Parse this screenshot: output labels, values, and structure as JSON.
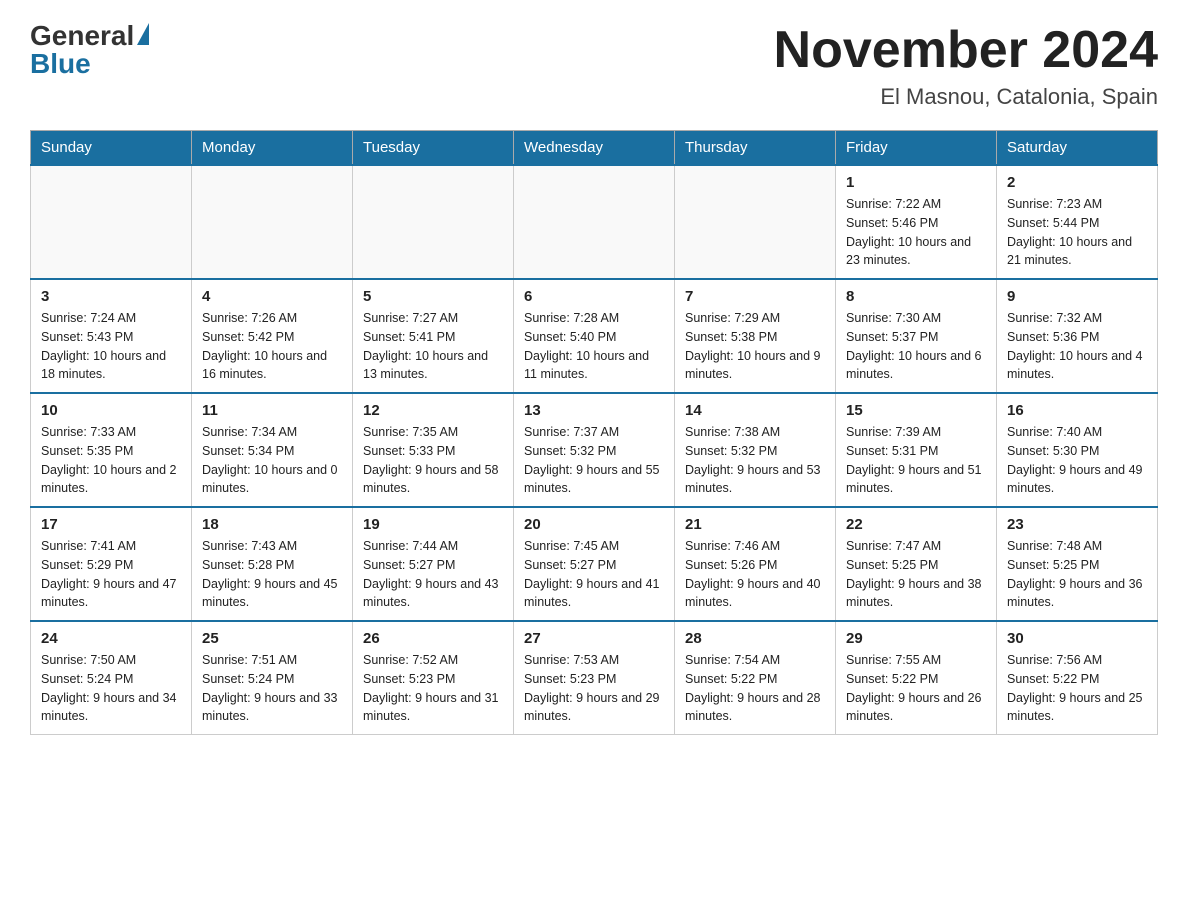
{
  "header": {
    "logo_general": "General",
    "logo_blue": "Blue",
    "month_year": "November 2024",
    "location": "El Masnou, Catalonia, Spain"
  },
  "days_of_week": [
    "Sunday",
    "Monday",
    "Tuesday",
    "Wednesday",
    "Thursday",
    "Friday",
    "Saturday"
  ],
  "weeks": [
    [
      {
        "day": "",
        "info": ""
      },
      {
        "day": "",
        "info": ""
      },
      {
        "day": "",
        "info": ""
      },
      {
        "day": "",
        "info": ""
      },
      {
        "day": "",
        "info": ""
      },
      {
        "day": "1",
        "info": "Sunrise: 7:22 AM\nSunset: 5:46 PM\nDaylight: 10 hours and 23 minutes."
      },
      {
        "day": "2",
        "info": "Sunrise: 7:23 AM\nSunset: 5:44 PM\nDaylight: 10 hours and 21 minutes."
      }
    ],
    [
      {
        "day": "3",
        "info": "Sunrise: 7:24 AM\nSunset: 5:43 PM\nDaylight: 10 hours and 18 minutes."
      },
      {
        "day": "4",
        "info": "Sunrise: 7:26 AM\nSunset: 5:42 PM\nDaylight: 10 hours and 16 minutes."
      },
      {
        "day": "5",
        "info": "Sunrise: 7:27 AM\nSunset: 5:41 PM\nDaylight: 10 hours and 13 minutes."
      },
      {
        "day": "6",
        "info": "Sunrise: 7:28 AM\nSunset: 5:40 PM\nDaylight: 10 hours and 11 minutes."
      },
      {
        "day": "7",
        "info": "Sunrise: 7:29 AM\nSunset: 5:38 PM\nDaylight: 10 hours and 9 minutes."
      },
      {
        "day": "8",
        "info": "Sunrise: 7:30 AM\nSunset: 5:37 PM\nDaylight: 10 hours and 6 minutes."
      },
      {
        "day": "9",
        "info": "Sunrise: 7:32 AM\nSunset: 5:36 PM\nDaylight: 10 hours and 4 minutes."
      }
    ],
    [
      {
        "day": "10",
        "info": "Sunrise: 7:33 AM\nSunset: 5:35 PM\nDaylight: 10 hours and 2 minutes."
      },
      {
        "day": "11",
        "info": "Sunrise: 7:34 AM\nSunset: 5:34 PM\nDaylight: 10 hours and 0 minutes."
      },
      {
        "day": "12",
        "info": "Sunrise: 7:35 AM\nSunset: 5:33 PM\nDaylight: 9 hours and 58 minutes."
      },
      {
        "day": "13",
        "info": "Sunrise: 7:37 AM\nSunset: 5:32 PM\nDaylight: 9 hours and 55 minutes."
      },
      {
        "day": "14",
        "info": "Sunrise: 7:38 AM\nSunset: 5:32 PM\nDaylight: 9 hours and 53 minutes."
      },
      {
        "day": "15",
        "info": "Sunrise: 7:39 AM\nSunset: 5:31 PM\nDaylight: 9 hours and 51 minutes."
      },
      {
        "day": "16",
        "info": "Sunrise: 7:40 AM\nSunset: 5:30 PM\nDaylight: 9 hours and 49 minutes."
      }
    ],
    [
      {
        "day": "17",
        "info": "Sunrise: 7:41 AM\nSunset: 5:29 PM\nDaylight: 9 hours and 47 minutes."
      },
      {
        "day": "18",
        "info": "Sunrise: 7:43 AM\nSunset: 5:28 PM\nDaylight: 9 hours and 45 minutes."
      },
      {
        "day": "19",
        "info": "Sunrise: 7:44 AM\nSunset: 5:27 PM\nDaylight: 9 hours and 43 minutes."
      },
      {
        "day": "20",
        "info": "Sunrise: 7:45 AM\nSunset: 5:27 PM\nDaylight: 9 hours and 41 minutes."
      },
      {
        "day": "21",
        "info": "Sunrise: 7:46 AM\nSunset: 5:26 PM\nDaylight: 9 hours and 40 minutes."
      },
      {
        "day": "22",
        "info": "Sunrise: 7:47 AM\nSunset: 5:25 PM\nDaylight: 9 hours and 38 minutes."
      },
      {
        "day": "23",
        "info": "Sunrise: 7:48 AM\nSunset: 5:25 PM\nDaylight: 9 hours and 36 minutes."
      }
    ],
    [
      {
        "day": "24",
        "info": "Sunrise: 7:50 AM\nSunset: 5:24 PM\nDaylight: 9 hours and 34 minutes."
      },
      {
        "day": "25",
        "info": "Sunrise: 7:51 AM\nSunset: 5:24 PM\nDaylight: 9 hours and 33 minutes."
      },
      {
        "day": "26",
        "info": "Sunrise: 7:52 AM\nSunset: 5:23 PM\nDaylight: 9 hours and 31 minutes."
      },
      {
        "day": "27",
        "info": "Sunrise: 7:53 AM\nSunset: 5:23 PM\nDaylight: 9 hours and 29 minutes."
      },
      {
        "day": "28",
        "info": "Sunrise: 7:54 AM\nSunset: 5:22 PM\nDaylight: 9 hours and 28 minutes."
      },
      {
        "day": "29",
        "info": "Sunrise: 7:55 AM\nSunset: 5:22 PM\nDaylight: 9 hours and 26 minutes."
      },
      {
        "day": "30",
        "info": "Sunrise: 7:56 AM\nSunset: 5:22 PM\nDaylight: 9 hours and 25 minutes."
      }
    ]
  ]
}
